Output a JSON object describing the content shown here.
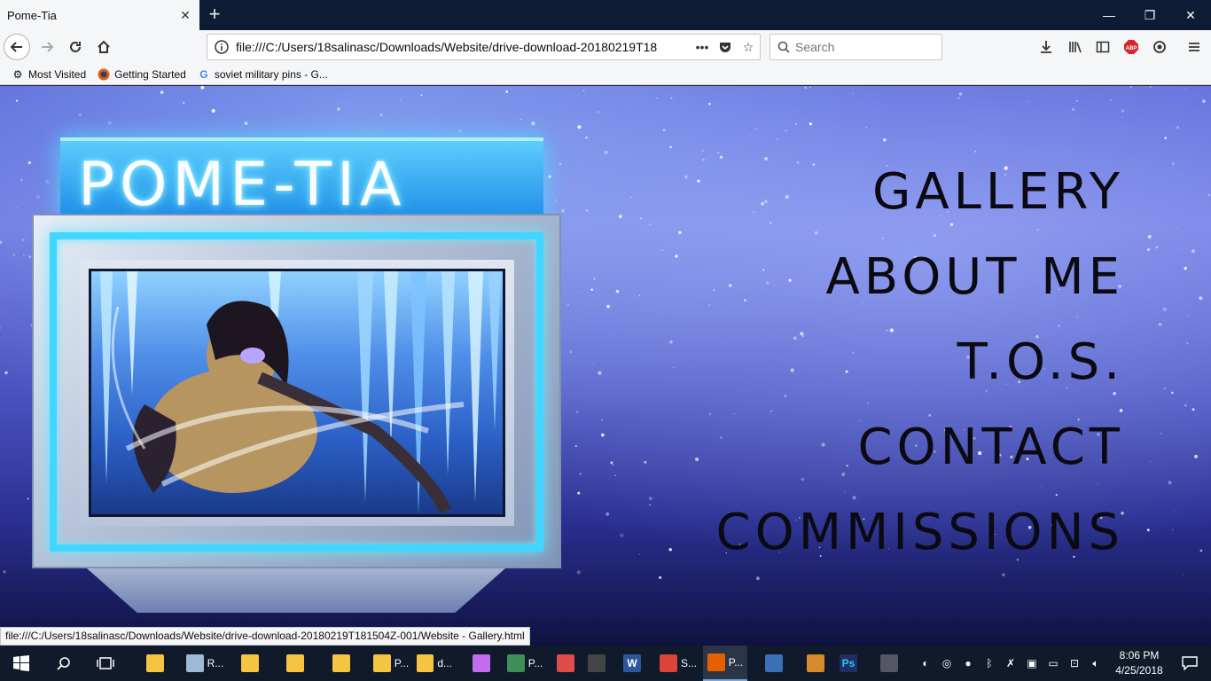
{
  "browser": {
    "tab": {
      "title": "Pome-Tia",
      "close": "✕"
    },
    "new_tab": "+",
    "window_controls": {
      "minimize": "—",
      "restore": "❐",
      "close": "✕"
    },
    "url": "file:///C:/Users/18salinasc/Downloads/Website/drive-download-20180219T18",
    "search_placeholder": "Search",
    "bookmarks": [
      {
        "label": "Most Visited",
        "icon": "gear-icon"
      },
      {
        "label": "Getting Started",
        "icon": "firefox-icon"
      },
      {
        "label": "soviet military pins - G...",
        "icon": "google-icon"
      }
    ],
    "status_url": "file:///C:/Users/18salinasc/Downloads/Website/drive-download-20180219T181504Z-001/Website - Gallery.html"
  },
  "site": {
    "logo": "POME-TIA",
    "menu": [
      "GALLERY",
      "ABOUT ME",
      "T.O.S.",
      "CONTACT",
      "COMMISSIONS"
    ],
    "colors": {
      "glow": "#3fd6ff",
      "menu_text": "#0a0a10"
    }
  },
  "taskbar": {
    "apps": [
      {
        "label": "",
        "icon": "file-explorer-icon"
      },
      {
        "label": "R...",
        "icon": "recycle-bin-icon"
      },
      {
        "label": "",
        "icon": "clipboard-icon"
      },
      {
        "label": "",
        "icon": "folder-icon"
      },
      {
        "label": "",
        "icon": "folder-icon"
      },
      {
        "label": "P...",
        "icon": "folder-icon"
      },
      {
        "label": "d...",
        "icon": "folder-icon"
      },
      {
        "label": "",
        "icon": "paint-icon"
      },
      {
        "label": "P...",
        "icon": "spreadsheet-icon"
      },
      {
        "label": "",
        "icon": "snipping-icon"
      },
      {
        "label": "",
        "icon": "obs-icon"
      },
      {
        "label": "",
        "icon": "word-icon"
      },
      {
        "label": "S...",
        "icon": "chrome-icon"
      },
      {
        "label": "P...",
        "icon": "firefox-icon"
      },
      {
        "label": "",
        "icon": "app-icon"
      },
      {
        "label": "",
        "icon": "game-icon"
      },
      {
        "label": "",
        "icon": "photoshop-icon"
      },
      {
        "label": "",
        "icon": "steam-icon"
      }
    ],
    "photoshop_badge": "Ps",
    "word_badge": "W",
    "time": "8:06 PM",
    "date": "4/25/2018"
  }
}
